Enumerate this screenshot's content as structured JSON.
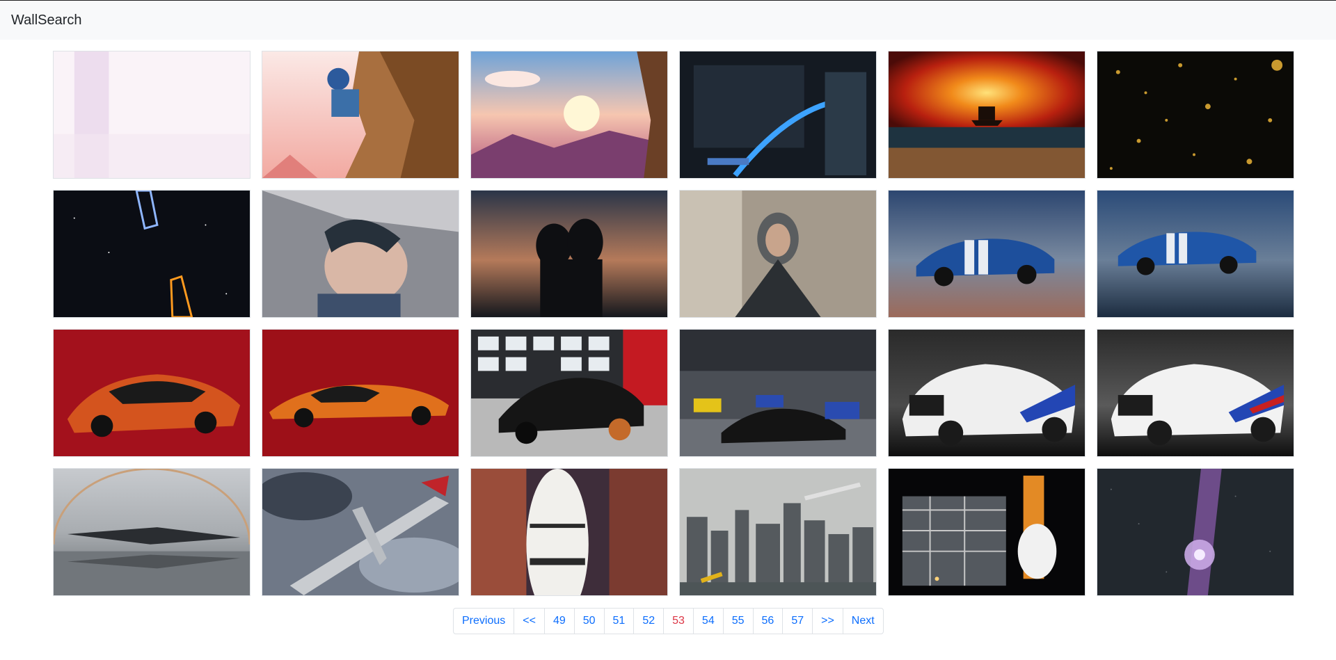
{
  "navbar": {
    "brand": "WallSearch"
  },
  "pagination": {
    "previous": "Previous",
    "first": "<<",
    "pages": [
      "49",
      "50",
      "51",
      "52",
      "53",
      "54",
      "55",
      "56",
      "57"
    ],
    "current": "53",
    "last": ">>",
    "next": "Next"
  },
  "colors": {
    "current_page": "#dc3545",
    "link": "#0d6efd",
    "navbar_bg": "#f8f9fa"
  }
}
